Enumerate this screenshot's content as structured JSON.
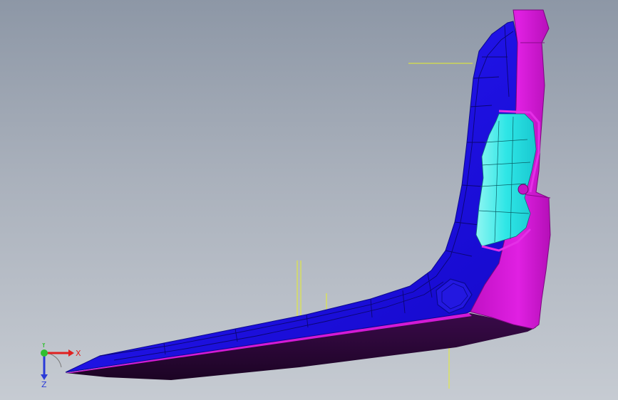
{
  "viewport": {
    "colors": {
      "background_top": "#8d97a6",
      "background_bottom": "#c6cbd2",
      "outer_surface": "#1f12f0",
      "outer_surface_edge": "#0a0890",
      "flange_surface": "#d414d6",
      "inner_cavity": "#33f2ee",
      "underside": "#2a0636",
      "annotation_lines": "#e7ef2a"
    }
  },
  "triad": {
    "x_label": "X",
    "y_label": "Y",
    "z_label": "Z",
    "colors": {
      "x": "#e02020",
      "y": "#2fbf2f",
      "z": "#2a3ad8"
    }
  }
}
